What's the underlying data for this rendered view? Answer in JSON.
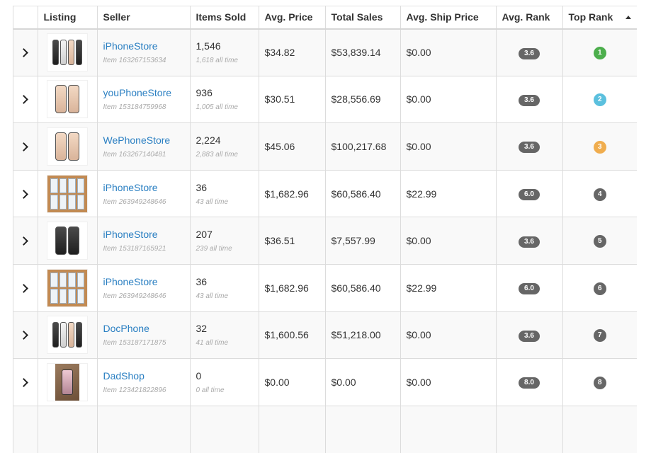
{
  "table": {
    "headers": {
      "expand": "",
      "listing": "Listing",
      "seller": "Seller",
      "items_sold": "Items Sold",
      "avg_price": "Avg. Price",
      "total_sales": "Total Sales",
      "avg_ship_price": "Avg. Ship Price",
      "avg_rank": "Avg. Rank",
      "top_rank": "Top Rank"
    },
    "sort": {
      "column": "top_rank",
      "direction": "ascending"
    },
    "rows": [
      {
        "thumb": "iphone-lineup",
        "seller": "iPhoneStore",
        "item": "Item 163267153634",
        "sold": "1,546",
        "sold_all": "1,618 all time",
        "avg_price": "$34.82",
        "total_sales": "$53,839.14",
        "ship": "$0.00",
        "avg_rank": "3.6",
        "top_rank": "1",
        "rank_color": "#4cae4c"
      },
      {
        "thumb": "iphone-gold-pair",
        "seller": "youPhoneStore",
        "item": "Item 153184759968",
        "sold": "936",
        "sold_all": "1,005 all time",
        "avg_price": "$30.51",
        "total_sales": "$28,556.69",
        "ship": "$0.00",
        "avg_rank": "3.6",
        "top_rank": "2",
        "rank_color": "#5bc0de"
      },
      {
        "thumb": "iphone-gold-pair",
        "seller": "WePhoneStore",
        "item": "Item 163267140481",
        "sold": "2,224",
        "sold_all": "2,883 all time",
        "avg_price": "$45.06",
        "total_sales": "$100,217.68",
        "ship": "$0.00",
        "avg_rank": "3.6",
        "top_rank": "3",
        "rank_color": "#f0ad4e"
      },
      {
        "thumb": "iphone-boxes",
        "seller": "iPhoneStore",
        "item": "Item 263949248646",
        "sold": "36",
        "sold_all": "43 all time",
        "avg_price": "$1,682.96",
        "total_sales": "$60,586.40",
        "ship": "$22.99",
        "avg_rank": "6.0",
        "top_rank": "4",
        "rank_color": "#666666"
      },
      {
        "thumb": "iphone-gray-pair",
        "seller": "iPhoneStore",
        "item": "Item 153187165921",
        "sold": "207",
        "sold_all": "239 all time",
        "avg_price": "$36.51",
        "total_sales": "$7,557.99",
        "ship": "$0.00",
        "avg_rank": "3.6",
        "top_rank": "5",
        "rank_color": "#666666"
      },
      {
        "thumb": "iphone-boxes",
        "seller": "iPhoneStore",
        "item": "Item 263949248646",
        "sold": "36",
        "sold_all": "43 all time",
        "avg_price": "$1,682.96",
        "total_sales": "$60,586.40",
        "ship": "$22.99",
        "avg_rank": "6.0",
        "top_rank": "6",
        "rank_color": "#666666"
      },
      {
        "thumb": "iphone-lineup",
        "seller": "DocPhone",
        "item": "Item 153187171875",
        "sold": "32",
        "sold_all": "41 all time",
        "avg_price": "$1,600.56",
        "total_sales": "$51,218.00",
        "ship": "$0.00",
        "avg_rank": "3.6",
        "top_rank": "7",
        "rank_color": "#666666"
      },
      {
        "thumb": "iphone-in-hand",
        "seller": "DadShop",
        "item": "Item 123421822896",
        "sold": "0",
        "sold_all": "0 all time",
        "avg_price": "$0.00",
        "total_sales": "$0.00",
        "ship": "$0.00",
        "avg_rank": "8.0",
        "top_rank": "8",
        "rank_color": "#666666"
      }
    ]
  }
}
